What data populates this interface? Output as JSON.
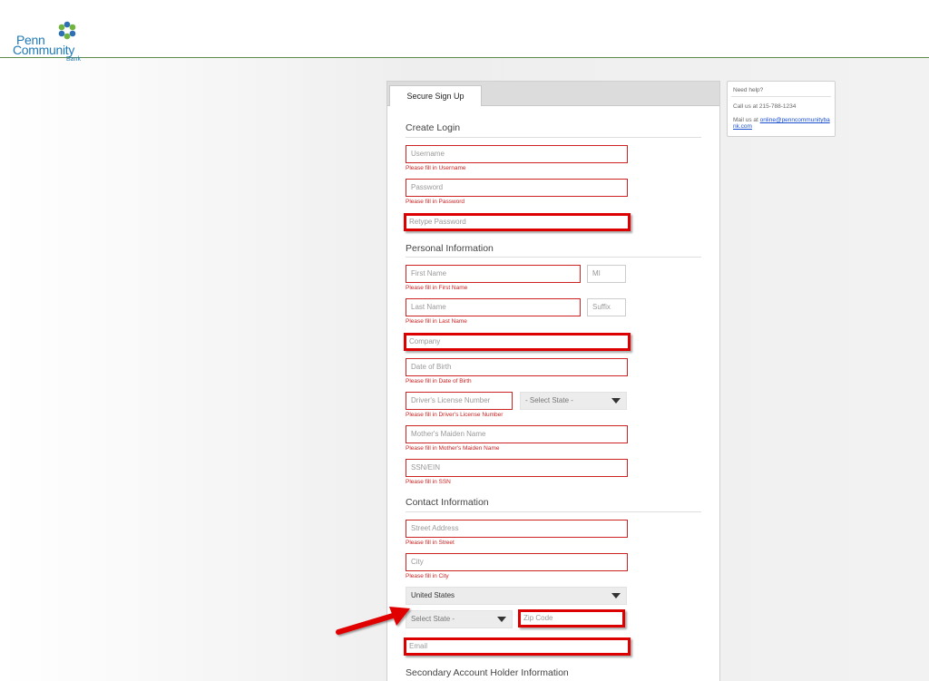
{
  "brand": {
    "line1": "Penn",
    "line2": "Community",
    "line3": "Bank",
    "color": "#1f7ab8"
  },
  "tab": {
    "label": "Secure Sign Up"
  },
  "sections": {
    "create_login": "Create Login",
    "personal": "Personal Information",
    "contact": "Contact Information",
    "secondary": "Secondary Account Holder Information"
  },
  "fields": {
    "username": {
      "placeholder": "Username",
      "error": "Please fill in Username"
    },
    "password": {
      "placeholder": "Password",
      "error": "Please fill in Password"
    },
    "retype_password": {
      "placeholder": "Retype Password"
    },
    "first_name": {
      "placeholder": "First Name",
      "error": "Please fill in First Name"
    },
    "mi": {
      "placeholder": "MI"
    },
    "last_name": {
      "placeholder": "Last Name",
      "error": "Please fill in Last Name"
    },
    "suffix": {
      "placeholder": "Suffix"
    },
    "company": {
      "placeholder": "Company"
    },
    "dob": {
      "placeholder": "Date of Birth",
      "error": "Please fill in Date of Birth"
    },
    "license": {
      "placeholder": "Driver's License Number",
      "error": "Please fill in Driver's License Number"
    },
    "license_state": {
      "value": "- Select State -"
    },
    "maiden": {
      "placeholder": "Mother's Maiden Name",
      "error": "Please fill in Mother's Maiden Name"
    },
    "ssn": {
      "placeholder": "SSN/EIN",
      "error": "Please fill in SSN"
    },
    "street": {
      "placeholder": "Street Address",
      "error": "Please fill in Street"
    },
    "city": {
      "placeholder": "City",
      "error": "Please fill in City"
    },
    "country": {
      "value": "United States"
    },
    "state": {
      "value": "Select State -"
    },
    "zip": {
      "placeholder": "Zip Code"
    },
    "email": {
      "placeholder": "Email"
    }
  },
  "help": {
    "title": "Need help?",
    "call": "Call us at 215-788-1234",
    "mail_prefix": "Mail us at ",
    "mail_link": "online@penncommunitybank.com"
  },
  "colors": {
    "error": "#cc2222",
    "highlight": "#dd0000",
    "divider": "#5d8c48"
  }
}
